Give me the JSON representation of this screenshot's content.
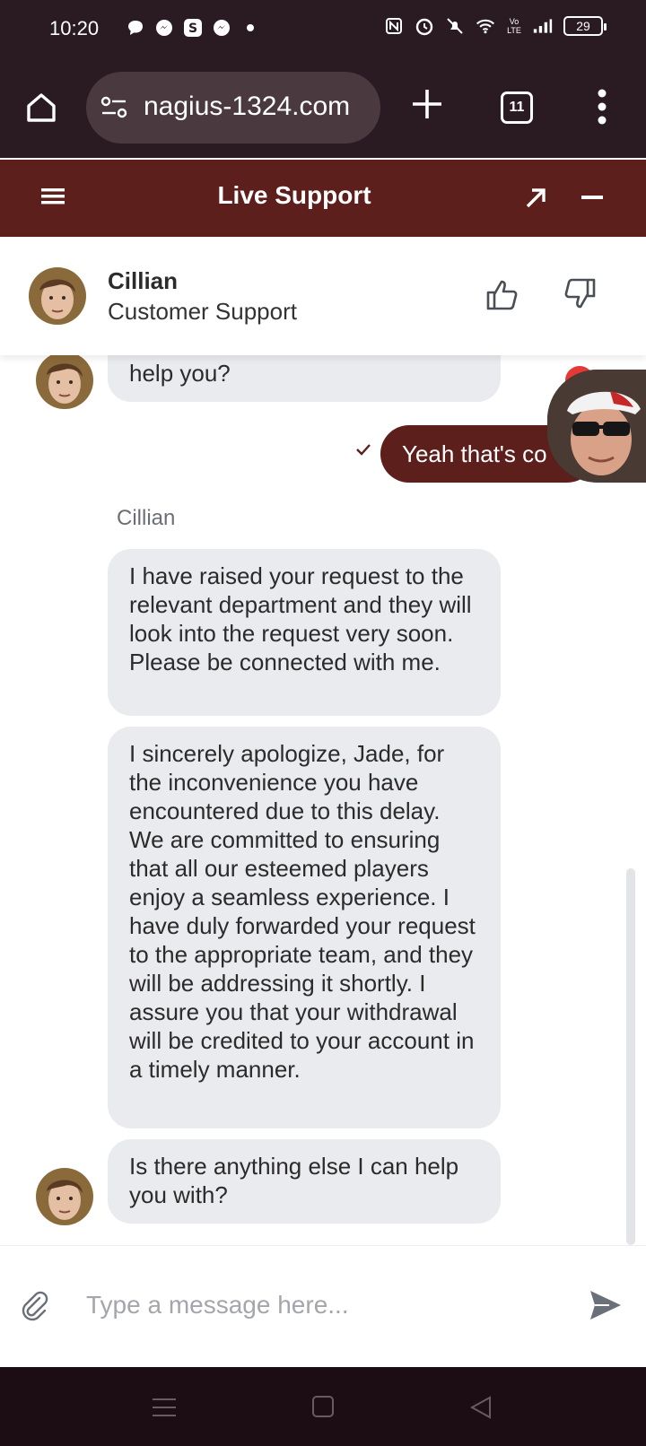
{
  "status_bar": {
    "time": "10:20",
    "network_label": "Vo LTE",
    "battery": "29",
    "left_icons": [
      "chat-bubble-icon",
      "messenger-icon",
      "skype-icon",
      "messenger-icon",
      "dot-icon"
    ],
    "right_icons": [
      "nfc-icon",
      "alarm-icon",
      "mute-icon",
      "wifi-icon",
      "signal-icon",
      "battery-icon"
    ]
  },
  "browser": {
    "url": "nagius-1324.com",
    "tab_count": "11"
  },
  "support_header": {
    "title": "Live Support"
  },
  "agent": {
    "name": "Cillian",
    "role": "Customer Support"
  },
  "messages": {
    "partial_top": "help you?",
    "user_reply": "Yeah that's co",
    "sender_label": "Cillian",
    "agent_1": "I have raised your request to the relevant department and they will look into the request very soon. Please be connected with me.",
    "agent_2": "I sincerely apologize, Jade, for the inconvenience you have encountered due to this delay. We are committed to ensuring that all our esteemed players enjoy a seamless experience. I have duly forwarded your request to the appropriate team, and they will be addressing it shortly. I assure you that your withdrawal will be credited to your account in a timely manner.",
    "agent_3": "Is there anything else I can help you with?"
  },
  "composer": {
    "placeholder": "Type a message here..."
  },
  "colors": {
    "brand": "#5c1f1c",
    "bubble": "#e9ebee",
    "system_bar": "#2a1a22"
  }
}
